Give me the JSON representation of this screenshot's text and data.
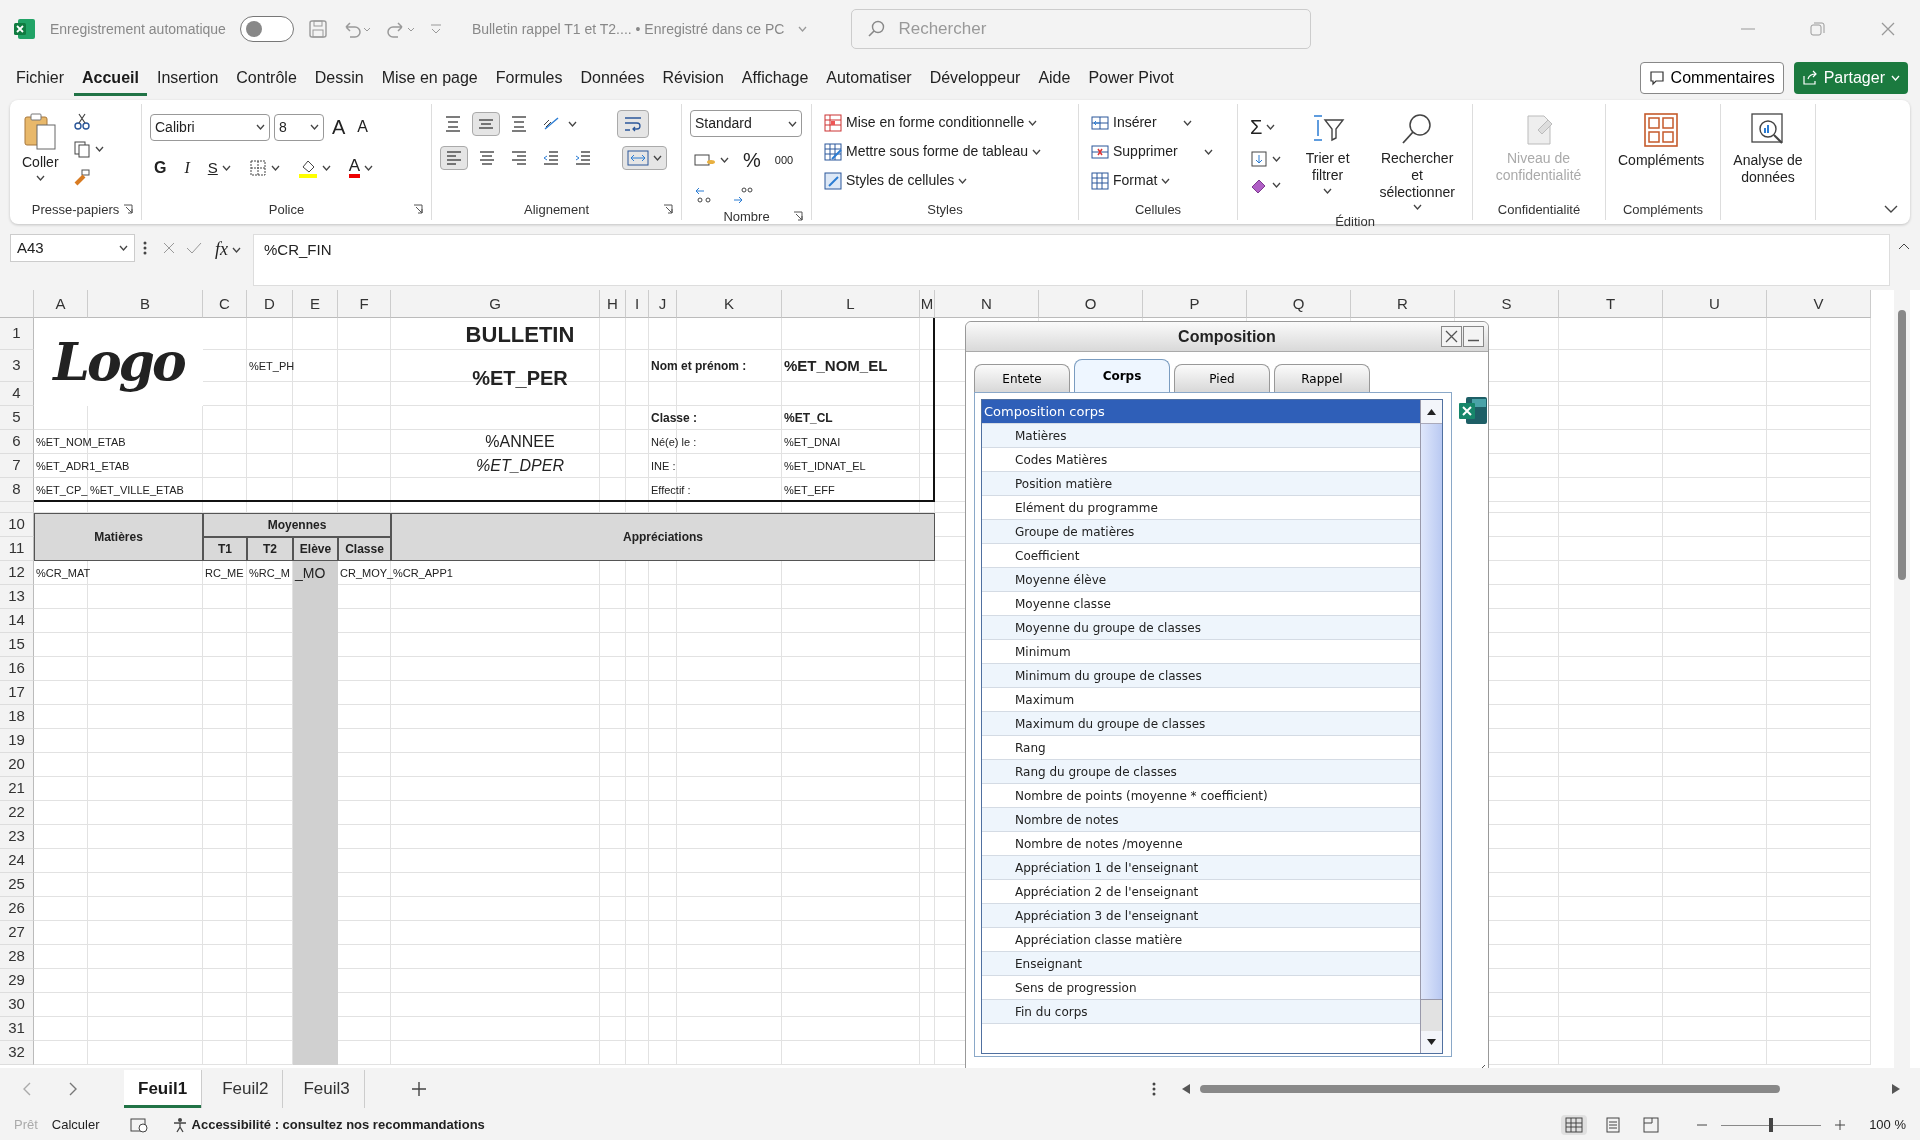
{
  "titlebar": {
    "autosave_label": "Enregistrement automatique",
    "autosave_on": false,
    "document": "Bulletin rappel T1 et T2.... • Enregistré dans ce PC",
    "search": {
      "placeholder": "Rechercher"
    }
  },
  "menu": {
    "tabs": [
      {
        "label": "Fichier",
        "selected": false
      },
      {
        "label": "Accueil",
        "selected": true
      },
      {
        "label": "Insertion",
        "selected": false
      },
      {
        "label": "Contrôle",
        "selected": false
      },
      {
        "label": "Dessin",
        "selected": false
      },
      {
        "label": "Mise en page",
        "selected": false
      },
      {
        "label": "Formules",
        "selected": false
      },
      {
        "label": "Données",
        "selected": false
      },
      {
        "label": "Révision",
        "selected": false
      },
      {
        "label": "Affichage",
        "selected": false
      },
      {
        "label": "Automatiser",
        "selected": false
      },
      {
        "label": "Développeur",
        "selected": false
      },
      {
        "label": "Aide",
        "selected": false
      },
      {
        "label": "Power Pivot",
        "selected": false
      }
    ],
    "comments": "Commentaires",
    "share": "Partager"
  },
  "ribbon": {
    "clipboard": {
      "label": "Presse-papiers",
      "paste": "Coller"
    },
    "font": {
      "label": "Police",
      "name": "Calibri",
      "size": "8",
      "grow_label": "A",
      "shrink_label": "A",
      "bold": "G",
      "italic": "I",
      "underline": "S",
      "tint_label": "A"
    },
    "alignment": {
      "label": "Alignement"
    },
    "number": {
      "label": "Nombre",
      "format": "Standard",
      "percent": "%",
      "thousands": "000"
    },
    "styles": {
      "label": "Styles",
      "items": [
        "Mise en forme conditionnelle",
        "Mettre sous forme de tableau",
        "Styles de cellules"
      ]
    },
    "cells": {
      "label": "Cellules",
      "items": [
        "Insérer",
        "Supprimer",
        "Format"
      ]
    },
    "editing": {
      "label": "Édition",
      "sum": "Σ",
      "sort": "Trier et filtrer",
      "find": "Rechercher et sélectionner"
    },
    "sensitivity": {
      "label": "Confidentialité",
      "button": "Niveau de confidentialité",
      "disabled": true
    },
    "addins": {
      "label": "Compléments",
      "button": "Compléments"
    },
    "analysis": {
      "button": "Analyse de données"
    }
  },
  "formula_bar": {
    "name_box": "A43",
    "fx": "fx",
    "formula": "%CR_FIN"
  },
  "sheet": {
    "columns": [
      "A",
      "B",
      "C",
      "D",
      "E",
      "F",
      "G",
      "H",
      "I",
      "J",
      "K",
      "L",
      "M",
      "N",
      "O",
      "P",
      "Q",
      "R",
      "S",
      "T",
      "U",
      "V"
    ],
    "rows": [
      {
        "number": "1",
        "kind": "tall"
      },
      {
        "number": "3",
        "kind": "tall"
      },
      {
        "number": "4",
        "kind": "normal"
      },
      {
        "number": "5",
        "kind": "normal"
      },
      {
        "number": "6",
        "kind": "normal"
      },
      {
        "number": "7",
        "kind": "normal"
      },
      {
        "number": "8",
        "kind": "normal"
      },
      {
        "kind": "thin"
      },
      {
        "number": "10",
        "kind": "normal"
      },
      {
        "number": "11",
        "kind": "normal"
      },
      {
        "number": "12",
        "kind": "normal"
      },
      {
        "number": "13",
        "kind": "normal"
      },
      {
        "number": "14",
        "kind": "normal"
      },
      {
        "number": "15",
        "kind": "normal"
      },
      {
        "number": "16",
        "kind": "normal"
      },
      {
        "number": "17",
        "kind": "normal"
      },
      {
        "number": "18",
        "kind": "normal"
      },
      {
        "number": "19",
        "kind": "normal"
      },
      {
        "number": "20",
        "kind": "normal"
      },
      {
        "number": "21",
        "kind": "normal"
      },
      {
        "number": "22",
        "kind": "normal"
      },
      {
        "number": "23",
        "kind": "normal"
      },
      {
        "number": "24",
        "kind": "normal"
      },
      {
        "number": "25",
        "kind": "normal"
      },
      {
        "number": "26",
        "kind": "normal"
      },
      {
        "number": "27",
        "kind": "normal"
      },
      {
        "number": "28",
        "kind": "normal"
      },
      {
        "number": "29",
        "kind": "normal"
      },
      {
        "number": "30",
        "kind": "normal"
      },
      {
        "number": "31",
        "kind": "normal"
      },
      {
        "number": "32",
        "kind": "normal"
      }
    ],
    "cells": [
      {
        "text": "Logo",
        "kind": "logo"
      },
      {
        "text": "BULLETIN",
        "kind": "title"
      },
      {
        "text": "%ET_PH",
        "kind": "plain"
      },
      {
        "text": "%ET_PER",
        "kind": "big"
      },
      {
        "text": "Nom et prénom :",
        "kind": "label"
      },
      {
        "text": "%ET_NOM_EL",
        "kind": "value"
      },
      {
        "text": "Classe :",
        "kind": "label"
      },
      {
        "text": "%ET_CL",
        "kind": "label"
      },
      {
        "text": "%ET_NOM_ETAB",
        "kind": "plain"
      },
      {
        "text": "%ANNEE",
        "kind": "center"
      },
      {
        "text": "Né(e) le :",
        "kind": "plain"
      },
      {
        "text": "%ET_DNAI",
        "kind": "plain"
      },
      {
        "text": "%ET_ADR1_ETAB",
        "kind": "plain"
      },
      {
        "text": "%ET_DPER",
        "kind": "italic"
      },
      {
        "text": "INE :",
        "kind": "plain"
      },
      {
        "text": "%ET_IDNAT_EL",
        "kind": "plain"
      },
      {
        "text": "%ET_CP_",
        "kind": "plain"
      },
      {
        "text": "%ET_VILLE_ETAB",
        "kind": "plain"
      },
      {
        "text": "Effectif :",
        "kind": "plain"
      },
      {
        "text": "%ET_EFF",
        "kind": "plain"
      },
      {
        "text": "Matières",
        "kind": "header"
      },
      {
        "text": "Moyennes",
        "kind": "header"
      },
      {
        "text": "Appréciations",
        "kind": "header"
      },
      {
        "text": "T1",
        "kind": "header"
      },
      {
        "text": "T2",
        "kind": "header"
      },
      {
        "text": "Elève",
        "kind": "header"
      },
      {
        "text": "Classe",
        "kind": "header"
      },
      {
        "text": "%CR_MAT",
        "kind": "plain"
      },
      {
        "text": "RC_ME",
        "kind": "plain"
      },
      {
        "text": "%RC_M",
        "kind": "plain"
      },
      {
        "text": "_MO",
        "kind": "shaded"
      },
      {
        "text": "CR_MOY_",
        "kind": "plain"
      },
      {
        "text": "%CR_APP1",
        "kind": "plain"
      }
    ]
  },
  "dialog": {
    "title": "Composition",
    "tabs": [
      {
        "label": "Entete",
        "selected": false
      },
      {
        "label": "Corps",
        "selected": true
      },
      {
        "label": "Pied",
        "selected": false
      },
      {
        "label": "Rappel",
        "selected": false
      }
    ],
    "items": [
      {
        "text": "Composition corps",
        "kind": "group",
        "selected": true
      },
      {
        "text": "Matières",
        "kind": "field",
        "selected": false
      },
      {
        "text": "Codes Matières",
        "kind": "field",
        "selected": false
      },
      {
        "text": "Position matière",
        "kind": "field",
        "selected": false
      },
      {
        "text": "Elément du programme",
        "kind": "field",
        "selected": false
      },
      {
        "text": "Groupe de matières",
        "kind": "field",
        "selected": false
      },
      {
        "text": "Coefficient",
        "kind": "field",
        "selected": false
      },
      {
        "text": "Moyenne élève",
        "kind": "field",
        "selected": false
      },
      {
        "text": "Moyenne classe",
        "kind": "field",
        "selected": false
      },
      {
        "text": "Moyenne du groupe de classes",
        "kind": "field",
        "selected": false
      },
      {
        "text": "Minimum",
        "kind": "field",
        "selected": false
      },
      {
        "text": "Minimum du groupe de classes",
        "kind": "field",
        "selected": false
      },
      {
        "text": "Maximum",
        "kind": "field",
        "selected": false
      },
      {
        "text": "Maximum du groupe de classes",
        "kind": "field",
        "selected": false
      },
      {
        "text": "Rang",
        "kind": "field",
        "selected": false
      },
      {
        "text": "Rang du groupe de classes",
        "kind": "field",
        "selected": false
      },
      {
        "text": "Nombre de points (moyenne * coefficient)",
        "kind": "field",
        "selected": false
      },
      {
        "text": "Nombre de notes",
        "kind": "field",
        "selected": false
      },
      {
        "text": "Nombre de notes /moyenne",
        "kind": "field",
        "selected": false
      },
      {
        "text": "Appréciation 1 de l'enseignant",
        "kind": "field",
        "selected": false
      },
      {
        "text": "Appréciation 2 de l'enseignant",
        "kind": "field",
        "selected": false
      },
      {
        "text": "Appréciation 3 de l'enseignant",
        "kind": "field",
        "selected": false
      },
      {
        "text": "Appréciation classe matière",
        "kind": "field",
        "selected": false
      },
      {
        "text": "Enseignant",
        "kind": "field",
        "selected": false
      },
      {
        "text": "Sens de progression",
        "kind": "field",
        "selected": false
      },
      {
        "text": "Fin du corps",
        "kind": "field",
        "selected": false
      }
    ]
  },
  "sheet_tabs": [
    {
      "label": "Feuil1",
      "selected": true
    },
    {
      "label": "Feuil2",
      "selected": false
    },
    {
      "label": "Feuil3",
      "selected": false
    }
  ],
  "status_bar": {
    "ready": "Prêt",
    "calculate": "Calculer",
    "accessibility": "Accessibilité : consultez nos recommandations",
    "zoom": {
      "level": 0.5,
      "reading": "100 %"
    }
  }
}
